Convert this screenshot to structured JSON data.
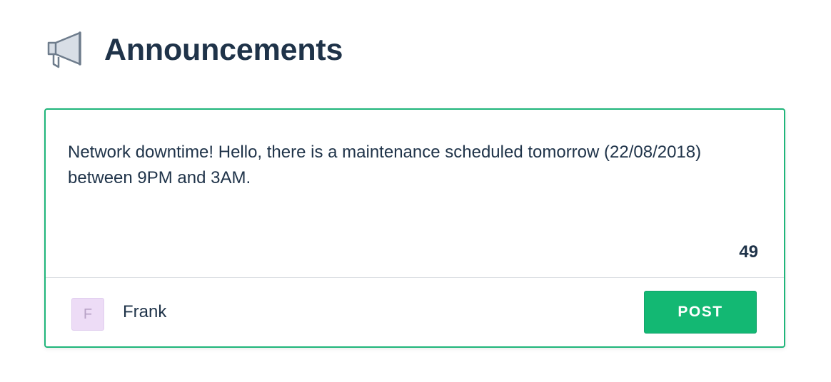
{
  "header": {
    "icon": "megaphone-icon",
    "title": "Announcements"
  },
  "composer": {
    "message": "Network downtime! Hello, there is a maintenance scheduled tomorrow (22/08/2018) between 9PM and 3AM.",
    "char_count": "49",
    "author": {
      "initial": "F",
      "name": "Frank"
    },
    "post_label": "POST"
  },
  "colors": {
    "accent": "#13b873",
    "border": "#1fb57a",
    "text": "#1f3349",
    "avatar_bg": "#eddcf6"
  }
}
